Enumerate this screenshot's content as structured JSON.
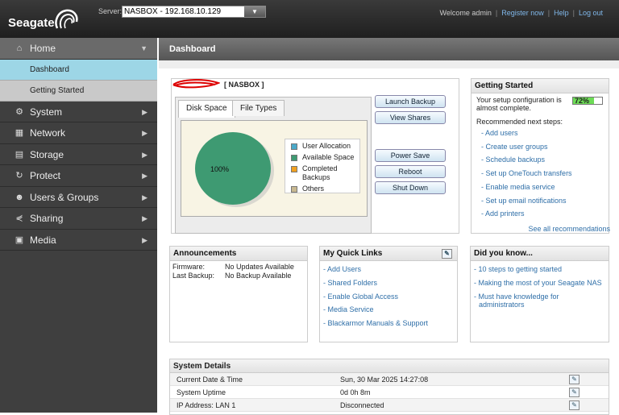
{
  "header": {
    "brand": "Seagate",
    "server_label": "Server:",
    "server_value": "NASBOX - 192.168.10.129",
    "welcome": "Welcome admin",
    "links": [
      "Register now",
      "Help",
      "Log out"
    ]
  },
  "sidebar": {
    "items": [
      {
        "label": "Home",
        "icon": "home-icon"
      },
      {
        "label": "System",
        "icon": "system-icon"
      },
      {
        "label": "Network",
        "icon": "network-icon"
      },
      {
        "label": "Storage",
        "icon": "storage-icon"
      },
      {
        "label": "Protect",
        "icon": "protect-icon"
      },
      {
        "label": "Users & Groups",
        "icon": "users-icon"
      },
      {
        "label": "Sharing",
        "icon": "sharing-icon"
      },
      {
        "label": "Media",
        "icon": "media-icon"
      }
    ],
    "home_subitems": [
      "Dashboard",
      "Getting Started"
    ]
  },
  "main": {
    "title": "Dashboard"
  },
  "nas_panel": {
    "title": "[ NASBOX ]",
    "tabs": [
      "Disk Space",
      "File Types"
    ],
    "pie_label": "100%",
    "legend": [
      {
        "label": "User Allocation",
        "color": "#4aa8c8"
      },
      {
        "label": "Available Space",
        "color": "#3e9a72"
      },
      {
        "label": "Completed Backups",
        "color": "#f0a020"
      },
      {
        "label": "Others",
        "color": "#c8b890"
      }
    ],
    "buttons": [
      "Launch Backup",
      "View Shares",
      "Power Save",
      "Reboot",
      "Shut Down"
    ]
  },
  "chart_data": {
    "type": "pie",
    "slices": [
      {
        "label": "User Allocation",
        "value": 0
      },
      {
        "label": "Available Space",
        "value": 100
      },
      {
        "label": "Completed Backups",
        "value": 0
      },
      {
        "label": "Others",
        "value": 0
      }
    ],
    "annotations": [
      "100%"
    ]
  },
  "getting_started": {
    "title": "Getting Started",
    "setup_text": "Your setup configuration is almost complete.",
    "progress_text": "72%",
    "progress": 0.72,
    "next_steps_label": "Recommended next steps:",
    "links": [
      "Add users",
      "Create user groups",
      "Schedule backups",
      "Set up OneTouch transfers",
      "Enable media service",
      "Set up email notifications",
      "Add printers"
    ],
    "see_all": "See all recommendations"
  },
  "announcements": {
    "title": "Announcements",
    "rows": [
      {
        "key": "Firmware:",
        "value": "No Updates Available"
      },
      {
        "key": "Last Backup:",
        "value": "No Backup Available"
      }
    ]
  },
  "quick_links": {
    "title": "My Quick Links",
    "links": [
      "Add Users",
      "Shared Folders",
      "Enable Global Access",
      "Media Service",
      "Blackarmor Manuals & Support"
    ]
  },
  "did_you_know": {
    "title": "Did you know...",
    "links": [
      "10 steps to getting started",
      "Making the most of your Seagate NAS",
      "Must have knowledge for administrators"
    ]
  },
  "system_details": {
    "title": "System Details",
    "rows": [
      {
        "label": "Current Date & Time",
        "value": "Sun, 30 Mar 2025 14:27:08"
      },
      {
        "label": "System Uptime",
        "value": "0d 0h 8m"
      },
      {
        "label": "IP Address: LAN 1",
        "value": "Disconnected"
      }
    ]
  }
}
